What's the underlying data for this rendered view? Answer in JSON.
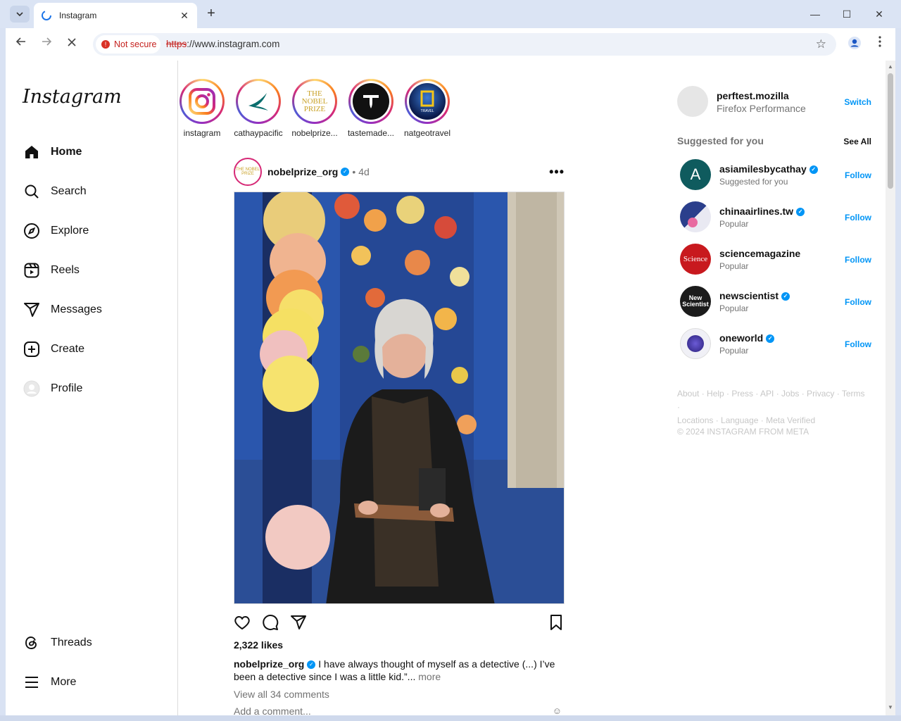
{
  "browser": {
    "tab_title": "Instagram",
    "tab_close": "✕",
    "new_tab": "+",
    "not_secure": "Not secure",
    "url_scheme": "https",
    "url_rest": "://www.instagram.com",
    "controls": {
      "minimize": "—",
      "maximize": "☐",
      "close": "✕"
    }
  },
  "sidebar": {
    "logo": "Instagram",
    "nav": [
      {
        "label": "Home"
      },
      {
        "label": "Search"
      },
      {
        "label": "Explore"
      },
      {
        "label": "Reels"
      },
      {
        "label": "Messages"
      },
      {
        "label": "Create"
      },
      {
        "label": "Profile"
      }
    ],
    "threads": "Threads",
    "more": "More"
  },
  "stories": [
    {
      "name": "instagram"
    },
    {
      "name": "cathaypacific"
    },
    {
      "name": "nobelprize..."
    },
    {
      "name": "tastemade..."
    },
    {
      "name": "natgeotravel"
    }
  ],
  "story_logo_nobel": "THE NOBEL PRIZE",
  "story_logo_natgeo": "TRAVEL",
  "post": {
    "username": "nobelprize_org",
    "dot": "•",
    "age": "4d",
    "avatar_text": "THE NOBEL PRIZE",
    "more": "•••",
    "likes": "2,322 likes",
    "caption_user": "nobelprize_org",
    "caption_text": " I have always thought of myself as a detective (...) I’ve been a detective since I was a little kid.”...",
    "caption_more": "more",
    "view_all": "View all 34 comments",
    "add_comment": "Add a comment..."
  },
  "right": {
    "me_user": "perftest.mozilla",
    "me_name": "Firefox Performance",
    "switch": "Switch",
    "suggested": "Suggested for you",
    "see_all": "See All",
    "suggestions": [
      {
        "user": "asiamilesbycathay",
        "sub": "Suggested for you",
        "follow": "Follow",
        "color": "#0f5b5e"
      },
      {
        "user": "chinaairlines.tw",
        "sub": "Popular",
        "follow": "Follow",
        "color": "#3a4a8c"
      },
      {
        "user": "sciencemagazine",
        "sub": "Popular",
        "follow": "Follow",
        "color": "#c8191e"
      },
      {
        "user": "newscientist",
        "sub": "Popular",
        "follow": "Follow",
        "color": "#1b1b1b"
      },
      {
        "user": "oneworld",
        "sub": "Popular",
        "follow": "Follow",
        "color": "#e8e8f0"
      }
    ],
    "avatar_texts": {
      "science": "Science",
      "newscientist": "New Scientist"
    },
    "footer_line1": "About · Help · Press · API · Jobs · Privacy · Terms ·",
    "footer_line2": "Locations · Language · Meta Verified",
    "copyright": "© 2024 INSTAGRAM FROM META"
  },
  "colors": {
    "accent": "#0095f6",
    "verified": "#0095f6",
    "notsecure": "#c5221f"
  }
}
